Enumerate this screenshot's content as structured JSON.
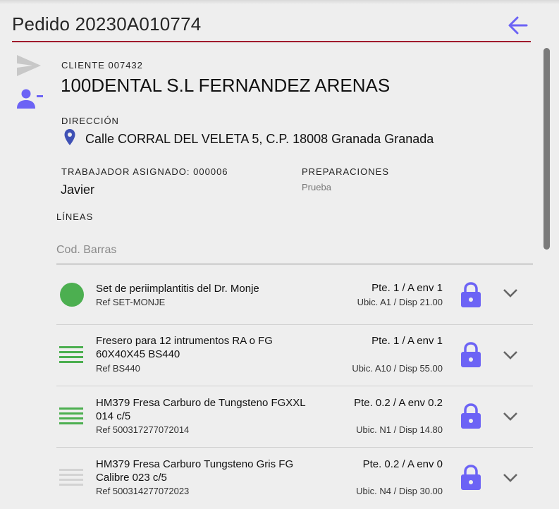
{
  "header": {
    "title": "Pedido 20230A010774",
    "back_icon": "arrow-left-icon"
  },
  "colors": {
    "accent": "#6c63f5",
    "divider": "#a01a2c",
    "green": "#4caf50",
    "grey_icon": "#c8c8c8"
  },
  "side_icons": [
    "send-icon",
    "remove-user-icon"
  ],
  "cliente": {
    "label": "CLIENTE 007432",
    "name": "100DENTAL S.L FERNANDEZ ARENAS"
  },
  "direccion": {
    "label": "DIRECCIÓN",
    "value": "Calle CORRAL DEL VELETA 5, C.P. 18008 Granada Granada"
  },
  "trabajador": {
    "label": "TRABAJADOR ASIGNADO: 000006",
    "value": "Javier"
  },
  "preparaciones": {
    "label": "PREPARACIONES",
    "value": "Prueba"
  },
  "lineas": {
    "label": "LÍNEAS",
    "barcode_placeholder": "Cod. Barras"
  },
  "items": [
    {
      "status": "complete-circle",
      "name": "Set de periimplantitis del Dr. Monje",
      "ref": "Ref SET-MONJE",
      "pte": "Pte. 1 / A env 1",
      "ubic": "Ubic. A1 / Disp 21.00"
    },
    {
      "status": "lines-green",
      "name": "Fresero para 12 intrumentos RA o FG 60X40X45 BS440",
      "ref": "Ref BS440",
      "pte": "Pte. 1 / A env 1",
      "ubic": "Ubic. A10 / Disp 55.00"
    },
    {
      "status": "lines-green",
      "name": "HM379 Fresa Carburo de Tungsteno FGXXL 014 c/5",
      "ref": "Ref 500317277072014",
      "pte": "Pte. 0.2 / A env 0.2",
      "ubic": "Ubic. N1 / Disp 14.80"
    },
    {
      "status": "lines-grey",
      "name": "HM379 Fresa Carburo Tungsteno Gris FG Calibre 023 c/5",
      "ref": "Ref 500314277072023",
      "pte": "Pte. 0.2 / A env 0",
      "ubic": "Ubic. N4 / Disp 30.00"
    }
  ]
}
